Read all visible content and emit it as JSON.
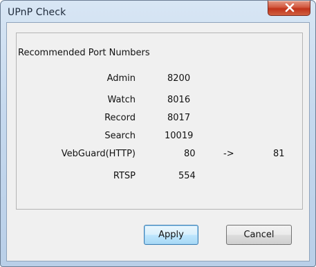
{
  "window": {
    "title": "UPnP Check",
    "close_label": "x"
  },
  "group": {
    "title": "Recommended Port Numbers"
  },
  "ports": [
    {
      "name": "Admin",
      "port": "8200"
    },
    {
      "name": "Watch",
      "port": "8016"
    },
    {
      "name": "Record",
      "port": "8017"
    },
    {
      "name": "Search",
      "port": "10019"
    },
    {
      "name": "VebGuard(HTTP)",
      "port": "80",
      "arrow": "->",
      "mapped": "81"
    },
    {
      "name": "RTSP",
      "port": "554"
    }
  ],
  "buttons": {
    "apply": "Apply",
    "cancel": "Cancel"
  },
  "icons": {
    "close": "close-icon"
  }
}
